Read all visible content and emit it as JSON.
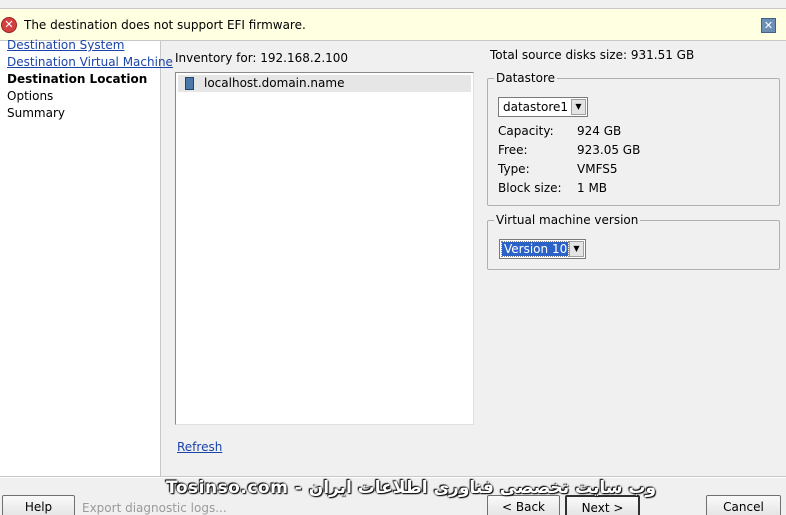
{
  "banner": {
    "message": "The destination does not support EFI firmware.",
    "error_icon": "error-icon",
    "close_icon": "close-icon"
  },
  "nav": {
    "items": [
      {
        "label": "Destination System",
        "state": "link"
      },
      {
        "label": "Destination Virtual Machine",
        "state": "link"
      },
      {
        "label": "Destination Location",
        "state": "current"
      },
      {
        "label": "Options",
        "state": "plain"
      },
      {
        "label": "Summary",
        "state": "plain"
      }
    ]
  },
  "inventory": {
    "label": "Inventory for: 192.168.2.100",
    "host": "localhost.domain.name",
    "host_icon": "server-icon",
    "refresh": "Refresh"
  },
  "source": {
    "total_disks": "Total source disks size:  931.51 GB"
  },
  "datastore": {
    "title": "Datastore",
    "selected": "datastore1",
    "capacity_label": "Capacity:",
    "capacity": "924 GB",
    "free_label": "Free:",
    "free": "923.05 GB",
    "type_label": "Type:",
    "type": "VMFS5",
    "block_label": "Block size:",
    "block": "1 MB"
  },
  "vm_version": {
    "title": "Virtual machine version",
    "selected": "Version 10"
  },
  "footer": {
    "help": "Help",
    "export": "Export diagnostic logs...",
    "back": "< Back",
    "next": "Next >",
    "cancel": "Cancel"
  },
  "watermark": "Tosinso.com - وب سایت تخصصی فناوری اطلاعات ایران",
  "colors": {
    "banner_bg": "#ffffe1",
    "link": "#1a44a8",
    "selection": "#2a62c8"
  }
}
